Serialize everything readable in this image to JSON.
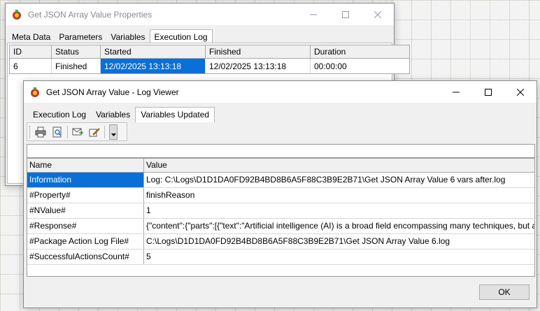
{
  "props_window": {
    "title": "Get JSON Array Value Properties",
    "tabs": [
      "Meta Data",
      "Parameters",
      "Variables",
      "Execution Log"
    ],
    "active_tab": 3,
    "table": {
      "headers": [
        "ID",
        "Status",
        "Started",
        "Finished",
        "Duration"
      ],
      "rows": [
        [
          "6",
          "Finished",
          "12/02/2025 13:13:18",
          "12/02/2025 13:13:18",
          "00:00:00"
        ]
      ]
    }
  },
  "log_window": {
    "title": "Get JSON Array Value - Log Viewer",
    "tabs": [
      "Execution Log",
      "Variables",
      "Variables Updated"
    ],
    "active_tab": 2,
    "toolbar": {
      "icons": [
        "print-icon",
        "print-preview-icon",
        "send-mail-icon",
        "edit-icon",
        "dropdown-arrow-icon"
      ]
    },
    "filter_value": "",
    "table": {
      "headers": [
        "Name",
        "Value"
      ],
      "rows": [
        [
          "Information",
          "Log: C:\\Logs\\D1D1DA0FD92B4BD8B6A5F88C3B9E2B71\\Get JSON Array Value 6 vars after.log"
        ],
        [
          "#Property#",
          "finishReason"
        ],
        [
          "#NValue#",
          "1"
        ],
        [
          "#Response#",
          "{\"content\":{\"parts\":[{\"text\":\"Artificial intelligence (AI) is a broad field encompassing many techniques, but at its core"
        ],
        [
          "#Package Action Log File#",
          "C:\\Logs\\D1D1DA0FD92B4BD8B6A5F88C3B9E2B71\\Get JSON Array Value 6.log"
        ],
        [
          "#SuccessfulActionsCount#",
          "5"
        ]
      ]
    },
    "ok_label": "OK"
  },
  "colors": {
    "selection": "#0a6fd6",
    "window_bg": "#f0f0f0"
  }
}
